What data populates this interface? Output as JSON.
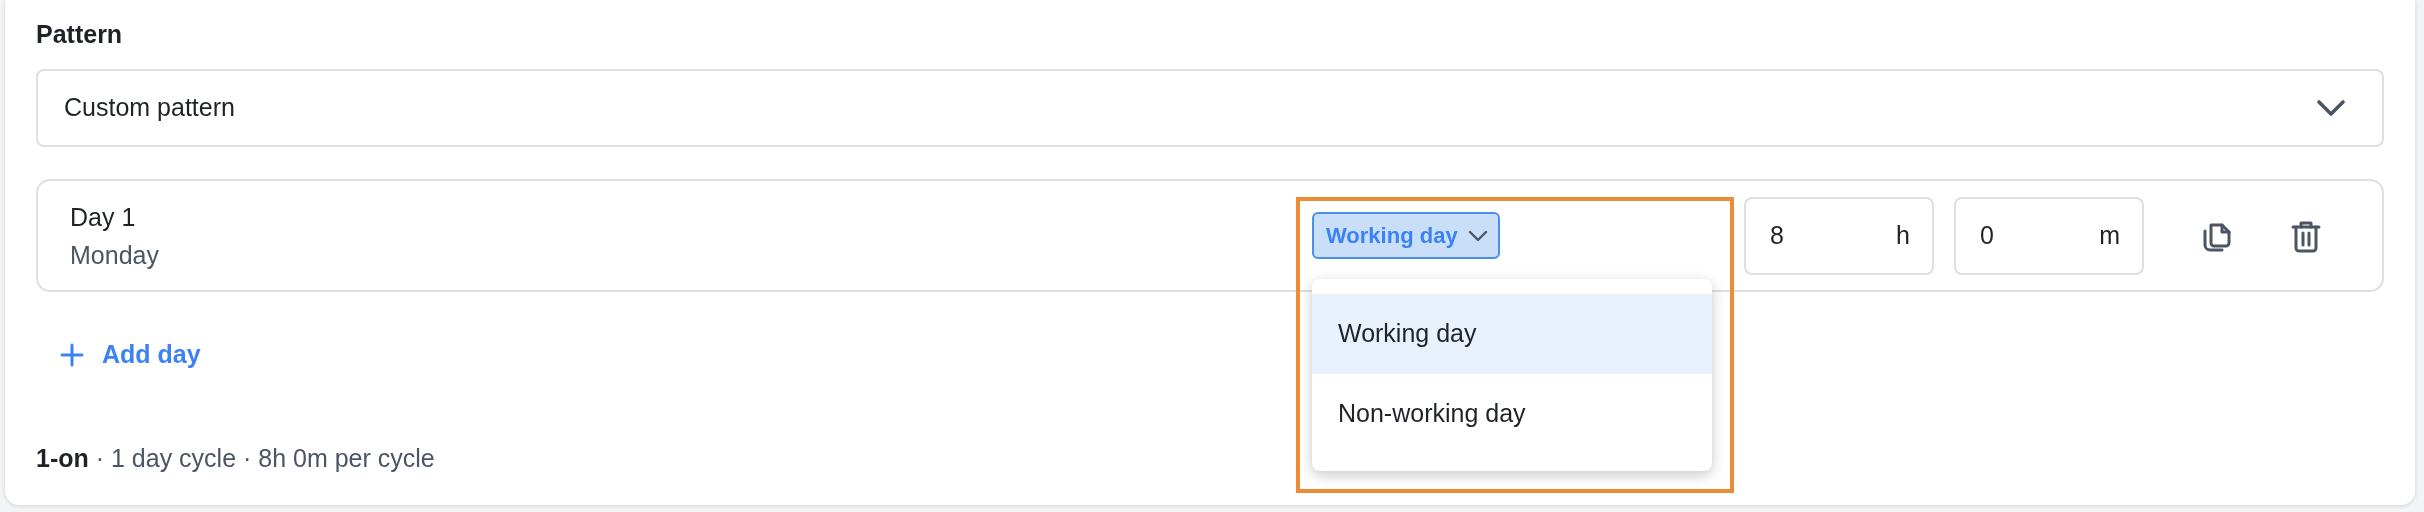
{
  "pattern": {
    "label": "Pattern",
    "value": "Custom pattern"
  },
  "days": [
    {
      "title": "Day 1",
      "weekday": "Monday",
      "type": "Working day",
      "hours": "8",
      "hours_unit": "h",
      "minutes": "0",
      "minutes_unit": "m",
      "menu_open": true
    }
  ],
  "type_menu": [
    {
      "label": "Working day",
      "selected": true
    },
    {
      "label": "Non-working day",
      "selected": false
    }
  ],
  "add_day": "Add day",
  "summary": "**1-on** · 1 day cycle · 8h 0m per cycle"
}
